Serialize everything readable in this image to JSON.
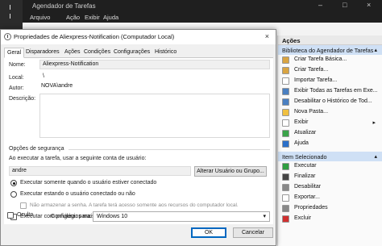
{
  "app": {
    "title": "Agendador de Tarefas",
    "menu": [
      "Arquivo",
      "Ação",
      "Exibir",
      "Ajuda"
    ],
    "window_controls": [
      "–",
      "□",
      "×"
    ]
  },
  "actions_panel": {
    "header": "Ações",
    "library_section": "Biblioteca do Agendador de Tarefas",
    "library_items": [
      {
        "label": "Criar Tarefa Básica...",
        "icon": "create-basic-task-icon",
        "color": "#d9a441"
      },
      {
        "label": "Criar Tarefa...",
        "icon": "create-task-icon",
        "color": "#d9a441"
      },
      {
        "label": "Importar Tarefa...",
        "icon": "import-task-icon",
        "color": "#ffffff"
      },
      {
        "label": "Exibir Todas as Tarefas em Exe...",
        "icon": "show-running-tasks-icon",
        "color": "#4a7fc1"
      },
      {
        "label": "Desabilitar o Histórico de Tod...",
        "icon": "disable-history-icon",
        "color": "#4a7fc1"
      },
      {
        "label": "Nova Pasta...",
        "icon": "new-folder-icon",
        "color": "#f0c040"
      },
      {
        "label": "Exibir",
        "icon": "view-icon",
        "color": "#ffffff",
        "submenu": "▸"
      },
      {
        "label": "Atualizar",
        "icon": "refresh-icon",
        "color": "#3aa34a"
      },
      {
        "label": "Ajuda",
        "icon": "help-icon",
        "color": "#2a6fc9"
      }
    ],
    "selected_section": "Item Selecionado",
    "selected_items": [
      {
        "label": "Executar",
        "icon": "run-icon",
        "color": "#2f9e41"
      },
      {
        "label": "Finalizar",
        "icon": "end-icon",
        "color": "#444444"
      },
      {
        "label": "Desabilitar",
        "icon": "disable-icon",
        "color": "#888888"
      },
      {
        "label": "Exportar...",
        "icon": "export-icon",
        "color": "#ffffff"
      },
      {
        "label": "Propriedades",
        "icon": "properties-icon",
        "color": "#888888"
      },
      {
        "label": "Excluir",
        "icon": "delete-icon",
        "color": "#d03030"
      }
    ],
    "collapse_caret": "▴"
  },
  "dialog": {
    "title": "Propriedades de Aliexpress-Notification (Computador Local)",
    "close": "×",
    "tabs": [
      "Geral",
      "Disparadores",
      "Ações",
      "Condições",
      "Configurações",
      "Histórico"
    ],
    "active_tab": "Geral",
    "fields": {
      "name_label": "Nome:",
      "name_value": "Aliexpress-Notification",
      "location_label": "Local:",
      "location_value": "\\",
      "author_label": "Autor:",
      "author_value": "NOVA\\andre",
      "description_label": "Descrição:",
      "description_value": ""
    },
    "security": {
      "group_title": "Opções de segurança",
      "run_as_text": "Ao executar a tarefa, usar a seguinte conta de usuário:",
      "user": "andre",
      "change_user_button": "Alterar Usuário ou Grupo...",
      "radio_logged_on": "Executar somente quando o usuário estiver conectado",
      "radio_whether": "Executar estando o usuário conectado ou não",
      "no_store_password": "Não armazenar a senha. A tarefa terá acesso somente aos recursos do computador local.",
      "highest_privileges": "Executar com privilégios mais altos"
    },
    "hidden_label": "Oculto",
    "configure_for_label": "Configurar para:",
    "configure_for_value": "Windows 10",
    "ok_button": "OK",
    "cancel_button": "Cancelar"
  }
}
